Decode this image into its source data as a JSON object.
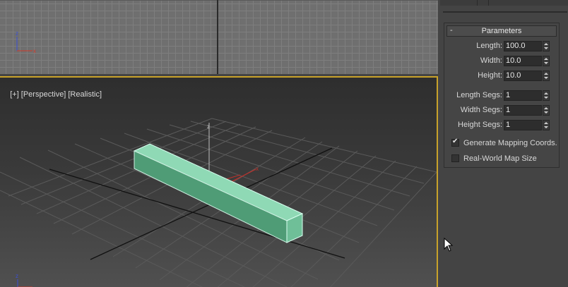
{
  "viewports": {
    "perspective": {
      "label_parts": [
        "[+]",
        "[Perspective]",
        "[Realistic]"
      ]
    },
    "axis_labels": {
      "z": "z",
      "x": "x"
    }
  },
  "parameters_panel": {
    "title": "Parameters",
    "collapse_symbol": "-",
    "fields": [
      {
        "label": "Length:",
        "value": "100.0"
      },
      {
        "label": "Width:",
        "value": "10.0"
      },
      {
        "label": "Height:",
        "value": "10.0"
      },
      {
        "label": "Length Segs:",
        "value": "1"
      },
      {
        "label": "Width Segs:",
        "value": "1"
      },
      {
        "label": "Height Segs:",
        "value": "1"
      }
    ],
    "checkboxes": [
      {
        "label": "Generate Mapping Coords.",
        "checked": true
      },
      {
        "label": "Real-World Map Size",
        "checked": false
      }
    ]
  },
  "colors": {
    "active_viewport_border": "#c8a22a",
    "box_top": "#8fd9b5",
    "box_front": "#4f9c76",
    "box_side": "#6fbf98",
    "gizmo_red": "#c0302a"
  },
  "icons": [
    "axis-tripod-icon",
    "mouse-cursor-icon",
    "spinner-arrows-icon",
    "checkbox-checked-icon"
  ]
}
